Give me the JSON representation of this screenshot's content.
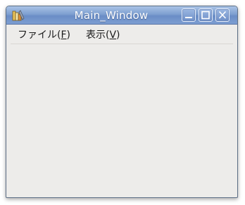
{
  "window": {
    "title": "Main_Window"
  },
  "titlebar": {
    "app_icon": "app-icon",
    "buttons": {
      "minimize_icon": "minimize-icon",
      "maximize_icon": "maximize-icon",
      "close_icon": "close-icon"
    },
    "colors": {
      "gradient_top": "#a9c3e6",
      "gradient_bottom": "#6a8dc6",
      "text": "#ffffff"
    }
  },
  "menubar": {
    "items": [
      {
        "label": "ファイル(",
        "mnemonic": "F",
        "suffix": ")"
      },
      {
        "label": "表示(",
        "mnemonic": "V",
        "suffix": ")"
      }
    ]
  },
  "colors": {
    "window_bg": "#edecea"
  }
}
